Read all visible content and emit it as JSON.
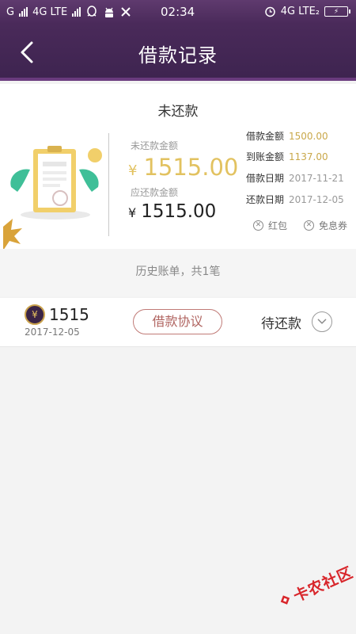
{
  "status_bar": {
    "carrier_left": "G",
    "network_left": "4G LTE",
    "time": "02:34",
    "network_right": "4G LTE₂"
  },
  "nav": {
    "title": "借款记录"
  },
  "summary": {
    "title": "未还款",
    "unpaid_label": "未还款金额",
    "unpaid_amount": "1515.00",
    "due_label": "应还款金额",
    "due_amount": "1515.00",
    "currency": "¥",
    "details": [
      {
        "label": "借款金额",
        "value": "1500.00"
      },
      {
        "label": "到账金额",
        "value": "1137.00"
      },
      {
        "label": "借款日期",
        "value": "2017-11-21"
      },
      {
        "label": "还款日期",
        "value": "2017-12-05"
      }
    ],
    "tags": [
      "红包",
      "免息券"
    ]
  },
  "history": {
    "header": "历史账单，共1笔"
  },
  "record": {
    "amount": "1515",
    "date": "2017-12-05",
    "agreement_label": "借款协议",
    "status": "待还款",
    "currency": "¥"
  },
  "watermark": {
    "text": "卡农社区"
  },
  "colors": {
    "header_purple": "#4a2a5a",
    "gold": "#e2c260",
    "agreement_border": "#c07a76"
  }
}
